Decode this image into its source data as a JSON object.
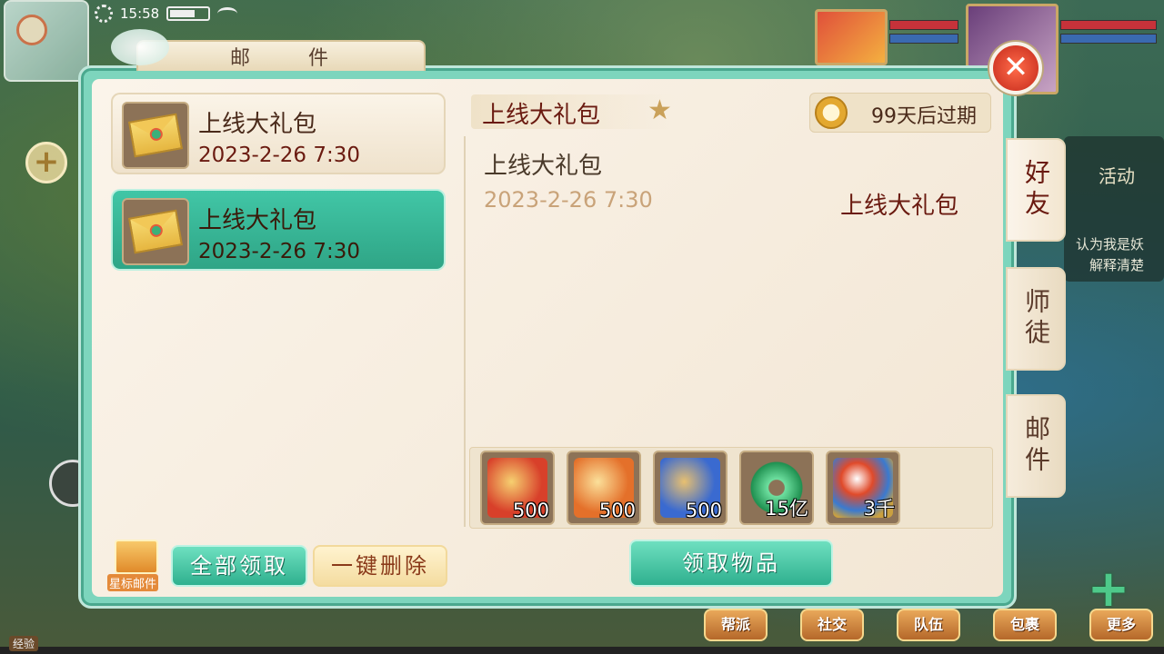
{
  "status_bar": {
    "time": "15:58"
  },
  "window": {
    "title_left": "邮",
    "title_right": "件",
    "close_icon": "close-icon"
  },
  "mail_list": [
    {
      "subject": "上线大礼包",
      "date": "2023-2-26 7:30",
      "selected": false
    },
    {
      "subject": "上线大礼包",
      "date": "2023-2-26 7:30",
      "selected": true
    }
  ],
  "detail": {
    "subject": "上线大礼包",
    "expire": "99天后过期",
    "body_title": "上线大礼包",
    "body_date": "2023-2-26 7:30",
    "sender": "上线大礼包"
  },
  "rewards": [
    {
      "icon": "red-scroll-icon",
      "qty": "500",
      "color": "#d8402a"
    },
    {
      "icon": "orange-scroll-icon",
      "qty": "500",
      "color": "#e4702a"
    },
    {
      "icon": "blue-scroll-icon",
      "qty": "500",
      "color": "#3a6ad0"
    },
    {
      "icon": "jade-icon",
      "qty": "15亿",
      "color": "#2fb060"
    },
    {
      "icon": "crystal-orb-icon",
      "qty": "3千",
      "color": "#e08a2a"
    }
  ],
  "buttons": {
    "claim_all": "全部领取",
    "delete_all": "一键删除",
    "claim_items": "领取物品",
    "star_mail": "星标邮件"
  },
  "side_tabs": [
    {
      "label": "好友"
    },
    {
      "label": "师徒"
    },
    {
      "label": "邮件"
    }
  ],
  "side_panel": {
    "activity": "活动",
    "text_line1": "认为我是妖",
    "text_line2": "解释清楚"
  },
  "bottom_nav": [
    "帮派",
    "社交",
    "队伍",
    "包裹",
    "更多"
  ],
  "hud": {
    "exp": "经验"
  },
  "colors": {
    "accent_green": "#2fb08e",
    "panel_cream": "#fbf4ea",
    "text_red": "#6a1a10"
  }
}
